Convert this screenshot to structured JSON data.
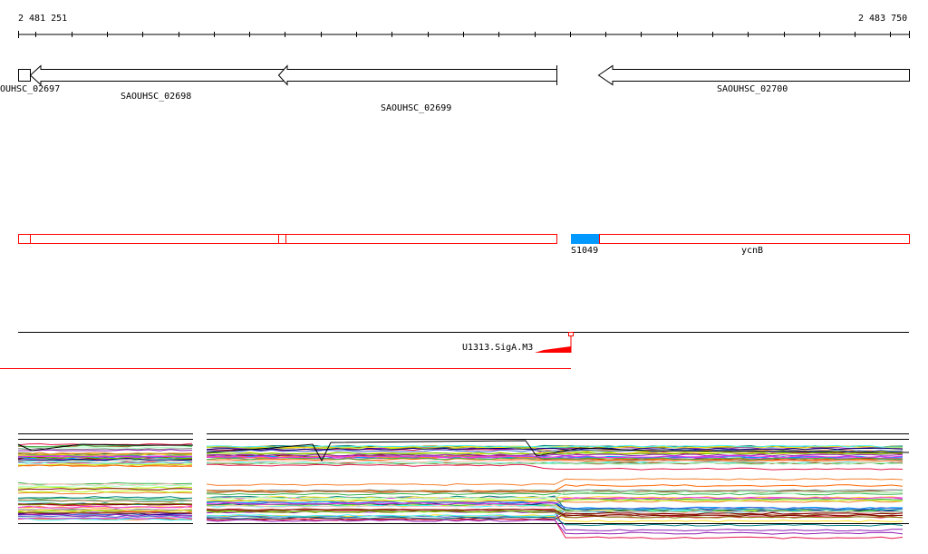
{
  "ruler": {
    "start_label": "2 481 251",
    "end_label": "2 483 750"
  },
  "genes": [
    {
      "label": "OUHSC_02697"
    },
    {
      "label": "SAOUHSC_02698"
    },
    {
      "label": "SAOUHSC_02699"
    },
    {
      "label": "SAOUHSC_02700"
    }
  ],
  "features": [
    {
      "label": "S1049"
    },
    {
      "label": "ycnB"
    }
  ],
  "promoter": {
    "label": "U1313.SigA.M3"
  },
  "colors": {
    "feature": "#ff0000",
    "highlight": "#0099ff"
  }
}
